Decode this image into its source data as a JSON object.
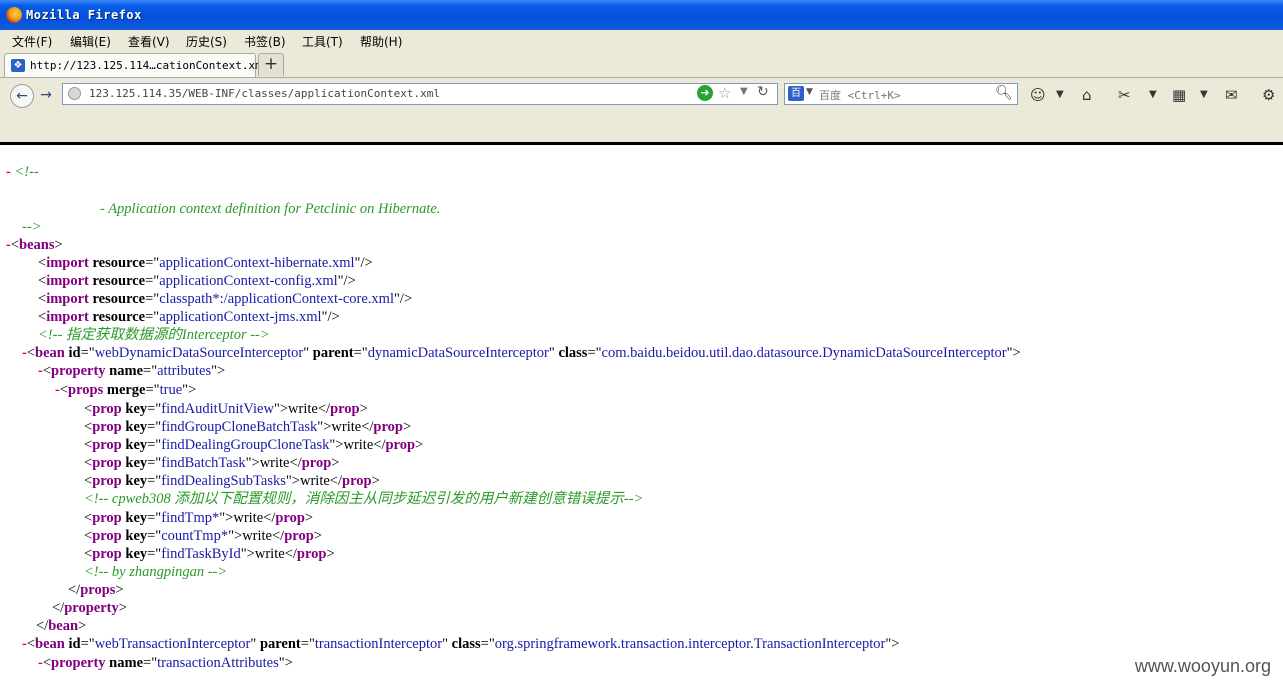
{
  "window": {
    "title": "Mozilla Firefox"
  },
  "menu": [
    "文件(F)",
    "编辑(E)",
    "查看(V)",
    "历史(S)",
    "书签(B)",
    "工具(T)",
    "帮助(H)"
  ],
  "tab": {
    "label": "http://123.125.114…cationContext.xml",
    "new_tab": "+"
  },
  "nav": {
    "url": "123.125.114.35/WEB-INF/classes/applicationContext.xml",
    "search_engine": "百",
    "search_placeholder": "百度 <Ctrl+K>"
  },
  "watermark": "www.wooyun.org",
  "xml": {
    "comment_open": "<!--",
    "comment_text": "- Application context definition for Petclinic on Hibernate.",
    "comment_close": "-->",
    "beans_tag": "beans",
    "imports": [
      "applicationContext-hibernate.xml",
      "applicationContext-config.xml",
      "classpath*:/applicationContext-core.xml",
      "applicationContext-jms.xml"
    ],
    "comment_interceptor": "<!-- 指定获取数据源的Interceptor -->",
    "bean1": {
      "id": "webDynamicDataSourceInterceptor",
      "parent": "dynamicDataSourceInterceptor",
      "class": "com.baidu.beidou.util.dao.datasource.DynamicDataSourceInterceptor"
    },
    "property1_name": "attributes",
    "props_merge": "true",
    "props_a": [
      {
        "key": "findAuditUnitView",
        "value": "write"
      },
      {
        "key": "findGroupCloneBatchTask",
        "value": "write"
      },
      {
        "key": "findDealingGroupCloneTask",
        "value": "write"
      },
      {
        "key": "findBatchTask",
        "value": "write"
      },
      {
        "key": "findDealingSubTasks",
        "value": "write"
      }
    ],
    "comment_cpweb": "<!--  cpweb308 添加以下配置规则，消除因主从同步延迟引发的用户新建创意错误提示-->",
    "props_b": [
      {
        "key": "findTmp*",
        "value": "write"
      },
      {
        "key": "countTmp*",
        "value": "write"
      },
      {
        "key": "findTaskById",
        "value": "write"
      }
    ],
    "comment_by": "<!--  by zhangpingan -->",
    "bean2": {
      "id": "webTransactionInterceptor",
      "parent": "transactionInterceptor",
      "class": "org.springframework.transaction.interceptor.TransactionInterceptor"
    },
    "property2_name": "transactionAttributes"
  }
}
